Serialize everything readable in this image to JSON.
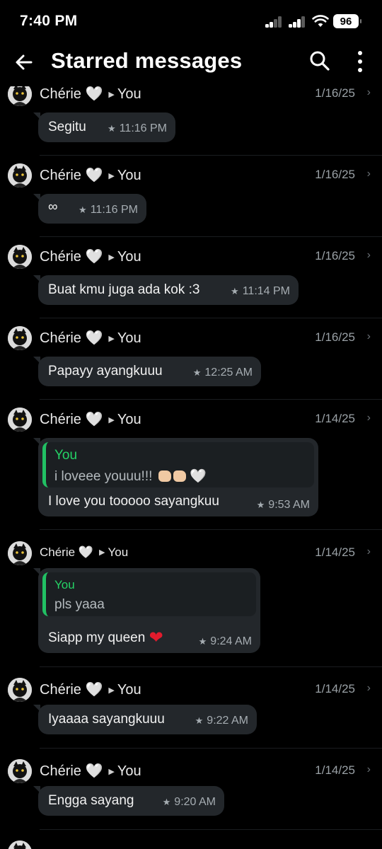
{
  "status_bar": {
    "time": "7:40 PM",
    "battery": "96"
  },
  "header": {
    "title": "Starred messages"
  },
  "messages": [
    {
      "sender": "Chérie",
      "heart": "🤍",
      "recipient": "You",
      "date": "1/16/25",
      "text": "Segitu",
      "time": "11:16 PM"
    },
    {
      "sender": "Chérie",
      "heart": "🤍",
      "recipient": "You",
      "date": "1/16/25",
      "text": "∞",
      "time": "11:16 PM"
    },
    {
      "sender": "Chérie",
      "heart": "🤍",
      "recipient": "You",
      "date": "1/16/25",
      "text": "Buat kmu juga ada kok :3",
      "time": "11:14 PM"
    },
    {
      "sender": "Chérie",
      "heart": "🤍",
      "recipient": "You",
      "date": "1/16/25",
      "text": "Papayy ayangkuuu",
      "time": "12:25 AM"
    },
    {
      "sender": "Chérie",
      "heart": "🤍",
      "recipient": "You",
      "date": "1/14/25",
      "quote_author": "You",
      "quote_text": "i loveee youuu!!!",
      "quote_heart": "🤍",
      "text": "I love you tooooo sayangkuu",
      "time": "9:53 AM"
    },
    {
      "sender": "Chérie",
      "heart": "🤍",
      "recipient": "You",
      "date": "1/14/25",
      "quote_author": "You",
      "quote_text": "pls yaaa",
      "text": "Siapp my queen",
      "text_heart": "❤",
      "time": "9:24 AM"
    },
    {
      "sender": "Chérie",
      "heart": "🤍",
      "recipient": "You",
      "date": "1/14/25",
      "text": "Iyaaaa sayangkuuu",
      "time": "9:22 AM"
    },
    {
      "sender": "Chérie",
      "heart": "🤍",
      "recipient": "You",
      "date": "1/14/25",
      "text": "Engga sayang",
      "time": "9:20 AM"
    }
  ]
}
